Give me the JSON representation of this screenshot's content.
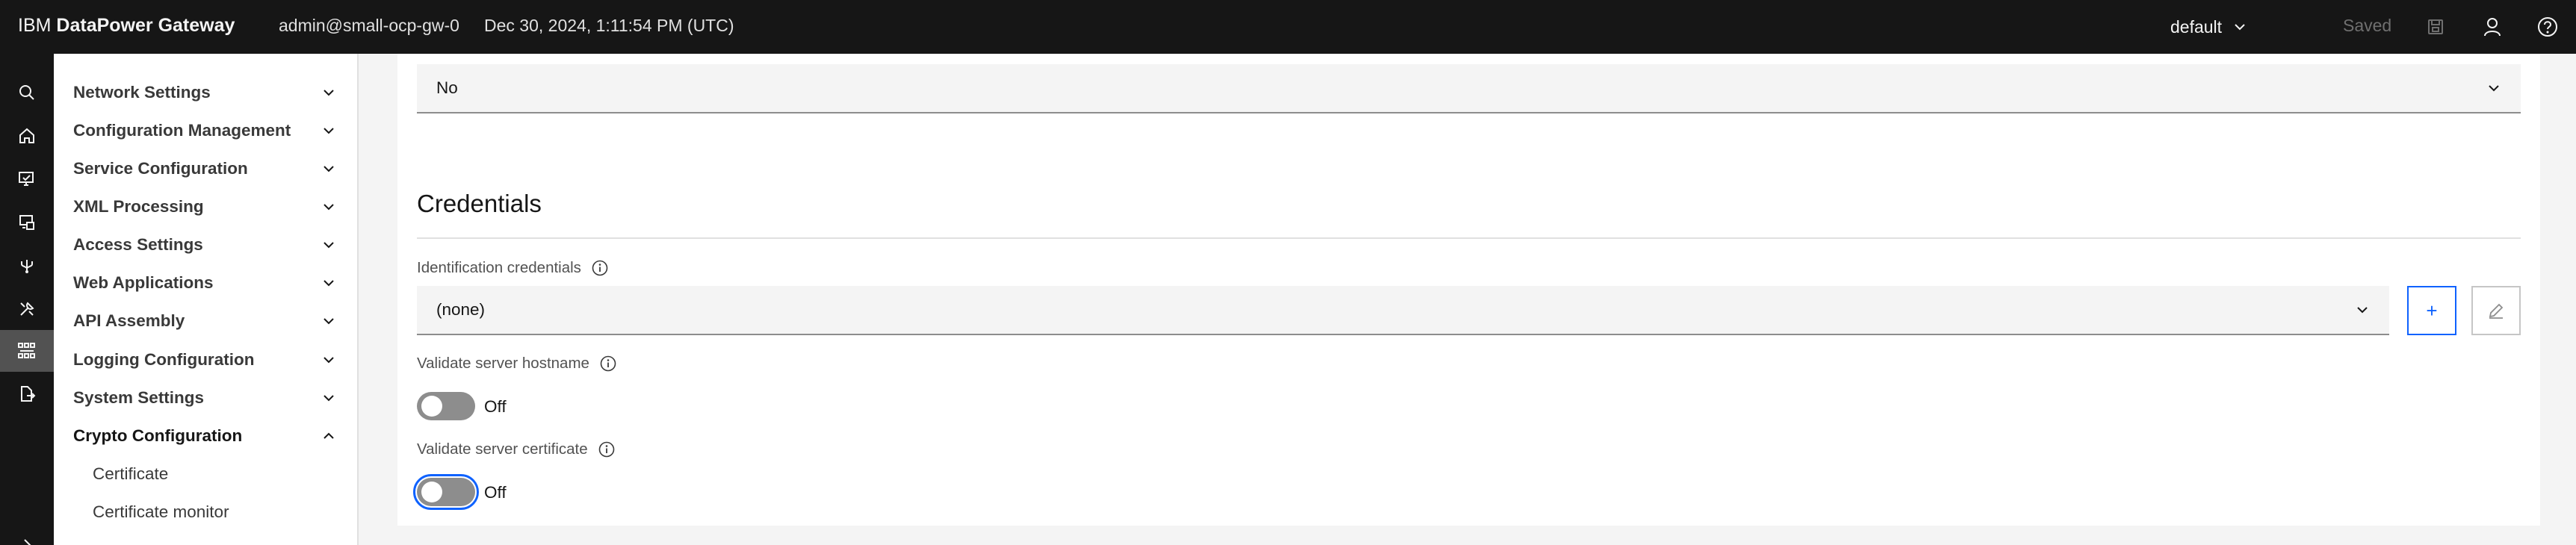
{
  "header": {
    "brand_prefix": "IBM",
    "brand_name": "DataPower Gateway",
    "user": "admin@small-ocp-gw-0",
    "datetime": "Dec 30, 2024, 1:11:54 PM (UTC)",
    "domain": "default",
    "saved_label": "Saved",
    "icons": [
      "chevron-down-icon",
      "save-icon",
      "user-icon",
      "help-icon"
    ]
  },
  "rail": {
    "icons": [
      "search-icon",
      "home-icon",
      "monitor-icon",
      "devices-icon",
      "flow-icon",
      "tools-icon",
      "services-icon",
      "file-export-icon",
      "expand-icon"
    ],
    "active": "services-icon"
  },
  "sidenav": {
    "items": [
      {
        "label": "Network Settings",
        "expanded": false
      },
      {
        "label": "Configuration Management",
        "expanded": false
      },
      {
        "label": "Service Configuration",
        "expanded": false
      },
      {
        "label": "XML Processing",
        "expanded": false
      },
      {
        "label": "Access Settings",
        "expanded": false
      },
      {
        "label": "Web Applications",
        "expanded": false
      },
      {
        "label": "API Assembly",
        "expanded": false
      },
      {
        "label": "Logging Configuration",
        "expanded": false
      },
      {
        "label": "System Settings",
        "expanded": false
      },
      {
        "label": "Crypto Configuration",
        "expanded": true
      }
    ],
    "subitems": [
      {
        "label": "Certificate"
      },
      {
        "label": "Certificate monitor"
      }
    ]
  },
  "main": {
    "top_select_value": "No",
    "credentials": {
      "title": "Credentials",
      "identification_label": "Identification credentials",
      "identification_value": "(none)",
      "add_label": "+",
      "validate_hostname_label": "Validate server hostname",
      "validate_hostname_state": "Off",
      "validate_certificate_label": "Validate server certificate",
      "validate_certificate_state": "Off"
    }
  },
  "colors": {
    "header_bg": "#161616",
    "accent": "#0f62fe",
    "field_bg": "#f4f4f4",
    "toggle_off": "#8d8d8d"
  }
}
